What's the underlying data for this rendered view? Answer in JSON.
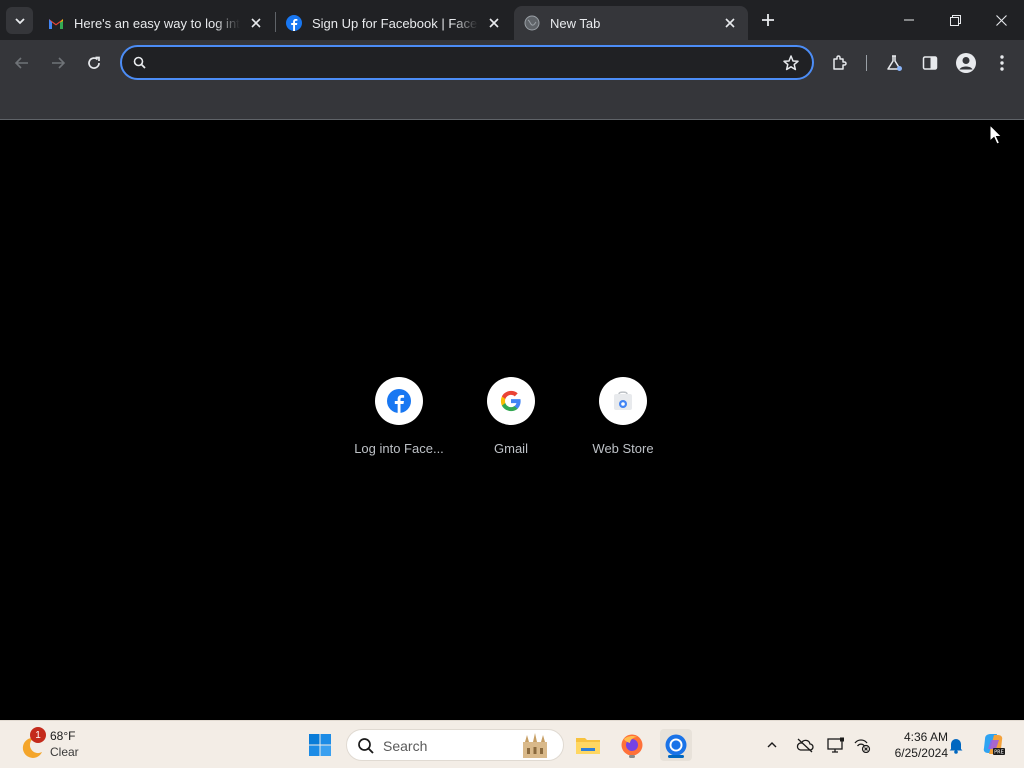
{
  "tabs": [
    {
      "title": "Here's an easy way to log into",
      "favicon": "gmail-icon",
      "active": false
    },
    {
      "title": "Sign Up for Facebook | Facebook",
      "favicon": "facebook-icon",
      "active": false
    },
    {
      "title": "New Tab",
      "favicon": "globe-icon",
      "active": true
    }
  ],
  "omnibox": {
    "value": "",
    "placeholder": ""
  },
  "shortcuts": [
    {
      "label": "Log into Face...",
      "icon": "facebook-icon"
    },
    {
      "label": "Gmail",
      "icon": "google-icon"
    },
    {
      "label": "Web Store",
      "icon": "webstore-icon"
    }
  ],
  "taskbar": {
    "weather": {
      "temp": "68°F",
      "condition": "Clear",
      "badge": "1"
    },
    "search_label": "Search",
    "clock": {
      "time": "4:36 AM",
      "date": "6/25/2024"
    }
  },
  "colors": {
    "accent": "#4c8df6",
    "toolbar": "#35363a",
    "tabstrip": "#202124",
    "taskbar": "#f3ede6"
  }
}
